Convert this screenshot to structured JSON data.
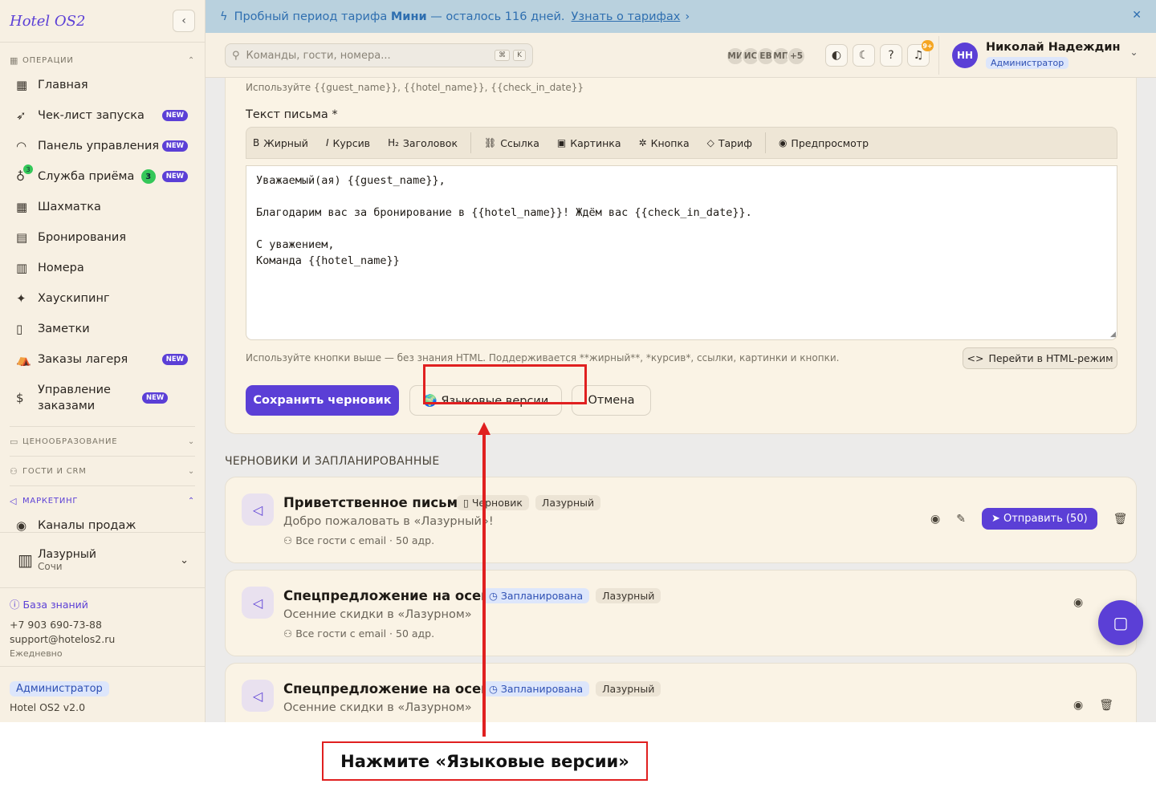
{
  "app": {
    "name": "Hotel OS2"
  },
  "sidebar": {
    "groups": [
      {
        "label": "ОПЕРАЦИИ",
        "active": false
      },
      {
        "label": "ЦЕНООБРАЗОВАНИЕ",
        "active": false
      },
      {
        "label": "ГОСТИ И CRM",
        "active": false
      },
      {
        "label": "МАРКЕТИНГ",
        "active": true
      }
    ],
    "items": [
      {
        "label": "Главная",
        "icon": "dashboard-icon"
      },
      {
        "label": "Чек-лист запуска",
        "icon": "rocket-icon",
        "badge": "NEW"
      },
      {
        "label": "Панель управления",
        "icon": "gauge-icon",
        "badge": "NEW"
      },
      {
        "label": "Служба приёма",
        "icon": "bell-desk-icon",
        "count": "3",
        "badge": "NEW"
      },
      {
        "label": "Шахматка",
        "icon": "grid-icon"
      },
      {
        "label": "Бронирования",
        "icon": "clipboard-icon"
      },
      {
        "label": "Номера",
        "icon": "building-icon"
      },
      {
        "label": "Хаускипинг",
        "icon": "sparkles-icon"
      },
      {
        "label": "Заметки",
        "icon": "note-icon"
      },
      {
        "label": "Заказы лагеря",
        "icon": "tent-icon",
        "badge": "NEW"
      },
      {
        "label": "Управление заказами",
        "icon": "receipt-icon",
        "badge": "NEW"
      },
      {
        "label": "Каналы продаж",
        "icon": "radio-icon"
      }
    ],
    "hotel": {
      "name": "Лазурный",
      "city": "Сочи"
    },
    "support": {
      "kb": "База знаний",
      "phone": "+7 903 690-73-88",
      "email": "support@hotelos2.ru",
      "hours": "Ежедневно"
    },
    "role": "Администратор",
    "version": "Hotel OS2 v2.0"
  },
  "banner": {
    "prefix": "Пробный период тарифа",
    "plan": "Мини",
    "suffix": "— осталось 116 дней.",
    "link": "Узнать о тарифах"
  },
  "topbar": {
    "search_placeholder": "Команды, гости, номера...",
    "kbd1": "⌘",
    "kbd2": "K",
    "avatars": [
      "МИ",
      "ИС",
      "ЕВ",
      "МП",
      "+5"
    ],
    "notif_count": "9+",
    "user_initials": "НН",
    "user_name": "Николай Надеждин",
    "user_role": "Администратор"
  },
  "editor": {
    "vars_hint": "Используйте {{guest_name}}, {{hotel_name}}, {{check_in_date}}",
    "label": "Текст письма *",
    "tools": [
      "Жирный",
      "Курсив",
      "Заголовок",
      "Ссылка",
      "Картинка",
      "Кнопка",
      "Тариф",
      "Предпросмотр"
    ],
    "body": "Уважаемый(ая) {{guest_name}},\n\nБлагодарим вас за бронирование в {{hotel_name}}! Ждём вас {{check_in_date}}.\n\nС уважением,\nКоманда {{hotel_name}}",
    "bottom_hint": "Используйте кнопки выше — без знания HTML. Поддерживается **жирный**, *курсив*, ссылки, картинки и кнопки.",
    "html_mode": "Перейти в HTML-режим",
    "save": "Сохранить черновик",
    "languages": "🌍 Языковые версии",
    "cancel": "Отмена"
  },
  "campaigns": {
    "section_title": "ЧЕРНОВИКИ И ЗАПЛАНИРОВАННЫЕ",
    "items": [
      {
        "title": "Приветственное письмо",
        "status": "Черновик",
        "hotel": "Лазурный",
        "subject": "Добро пожаловать в «Лазурный»!",
        "audience": "Все гости с email · 50 адр.",
        "send": "Отправить (50)"
      },
      {
        "title": "Спецпредложение на осень",
        "status": "Запланирована",
        "hotel": "Лазурный",
        "subject": "Осенние скидки в «Лазурном»",
        "audience": "Все гости с email · 50 адр."
      },
      {
        "title": "Спецпредложение на осень",
        "status": "Запланирована",
        "hotel": "Лазурный",
        "subject": "Осенние скидки в «Лазурном»"
      }
    ]
  },
  "annotation": {
    "text": "Нажмите «Языковые версии»"
  },
  "colors": {
    "accent": "#5b3fd6",
    "highlight": "#e02020",
    "banner": "#b9d1de"
  }
}
